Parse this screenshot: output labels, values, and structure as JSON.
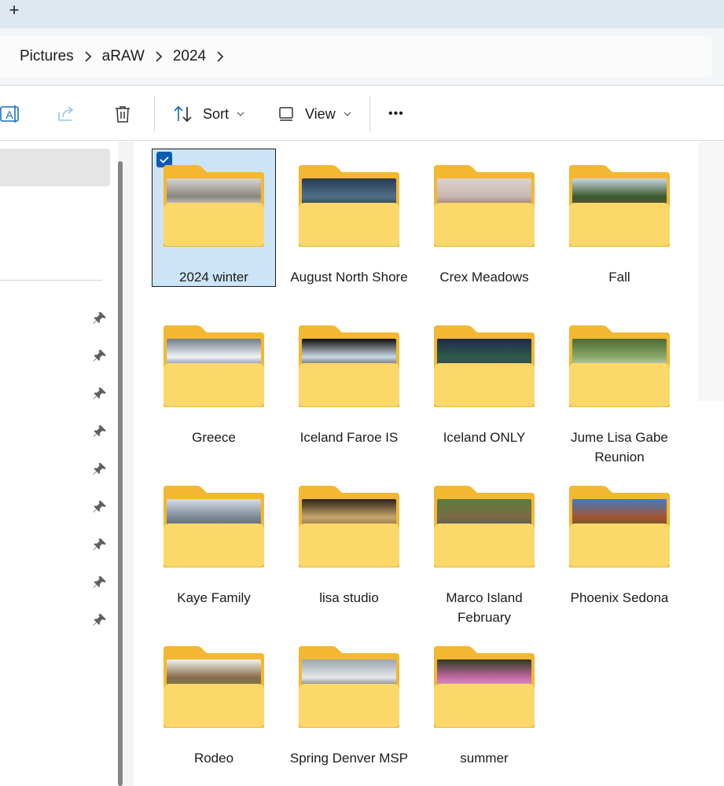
{
  "toolbar_tabs": {
    "new_tab_icon": "plus-icon",
    "new_tab_label": "+"
  },
  "breadcrumb": [
    "Pictures",
    "aRAW",
    "2024"
  ],
  "commands": {
    "rename_icon": "rename-icon",
    "share_icon": "share-icon",
    "delete_icon": "trash-icon",
    "sort_label": "Sort",
    "view_label": "View",
    "more_label": "•••"
  },
  "colors": {
    "folder_back": "#f4b731",
    "folder_front": "#fcd86a",
    "selection_bg": "#cce4f7",
    "checkbox": "#0b5cad"
  },
  "folders": [
    {
      "name": "2024 winter",
      "selected": true,
      "photo": [
        "#d9d4cf",
        "#8a8680",
        "#ffffff"
      ]
    },
    {
      "name": "August North Shore",
      "selected": false,
      "photo": [
        "#2a3b53",
        "#4f6e8a",
        "#1b2a1c"
      ]
    },
    {
      "name": "Crex Meadows",
      "selected": false,
      "photo": [
        "#dcd2cc",
        "#c9b7ae",
        "#7d5a3c"
      ]
    },
    {
      "name": "Fall",
      "selected": false,
      "photo": [
        "#c9d7e3",
        "#3c5a2e",
        "#705238"
      ]
    },
    {
      "name": "Greece",
      "selected": false,
      "photo": [
        "#6f7c88",
        "#f1f2f5",
        "#243d7a"
      ]
    },
    {
      "name": "Iceland Faroe IS",
      "selected": false,
      "photo": [
        "#0d0d0d",
        "#c9d8e4",
        "#111111"
      ]
    },
    {
      "name": "Iceland ONLY",
      "selected": false,
      "photo": [
        "#1d2a4a",
        "#2e5b4a",
        "#3a3f63"
      ]
    },
    {
      "name": "Jume Lisa Gabe Reunion",
      "selected": false,
      "photo": [
        "#4a6b34",
        "#8ba86b",
        "#e3e3e3"
      ]
    },
    {
      "name": "Kaye Family",
      "selected": false,
      "photo": [
        "#d7dde6",
        "#7a8896",
        "#4b5867"
      ]
    },
    {
      "name": "lisa studio",
      "selected": false,
      "photo": [
        "#2a2119",
        "#c7a66a",
        "#6b5135"
      ]
    },
    {
      "name": "Marco Island February",
      "selected": false,
      "photo": [
        "#5a7d3b",
        "#7c6a45",
        "#2e4f6e"
      ]
    },
    {
      "name": "Phoenix Sedona",
      "selected": false,
      "photo": [
        "#3f7bc4",
        "#a5542f",
        "#3d5a2a"
      ]
    },
    {
      "name": "Rodeo",
      "selected": false,
      "photo": [
        "#f1f2ef",
        "#8a6b4a",
        "#6a8a44"
      ]
    },
    {
      "name": "Spring Denver MSP",
      "selected": false,
      "photo": [
        "#9aa6b0",
        "#e6e7ea",
        "#2b2b2b"
      ]
    },
    {
      "name": "summer",
      "selected": false,
      "photo": [
        "#2d3b1f",
        "#c46aa5",
        "#e9b3d5"
      ]
    }
  ]
}
